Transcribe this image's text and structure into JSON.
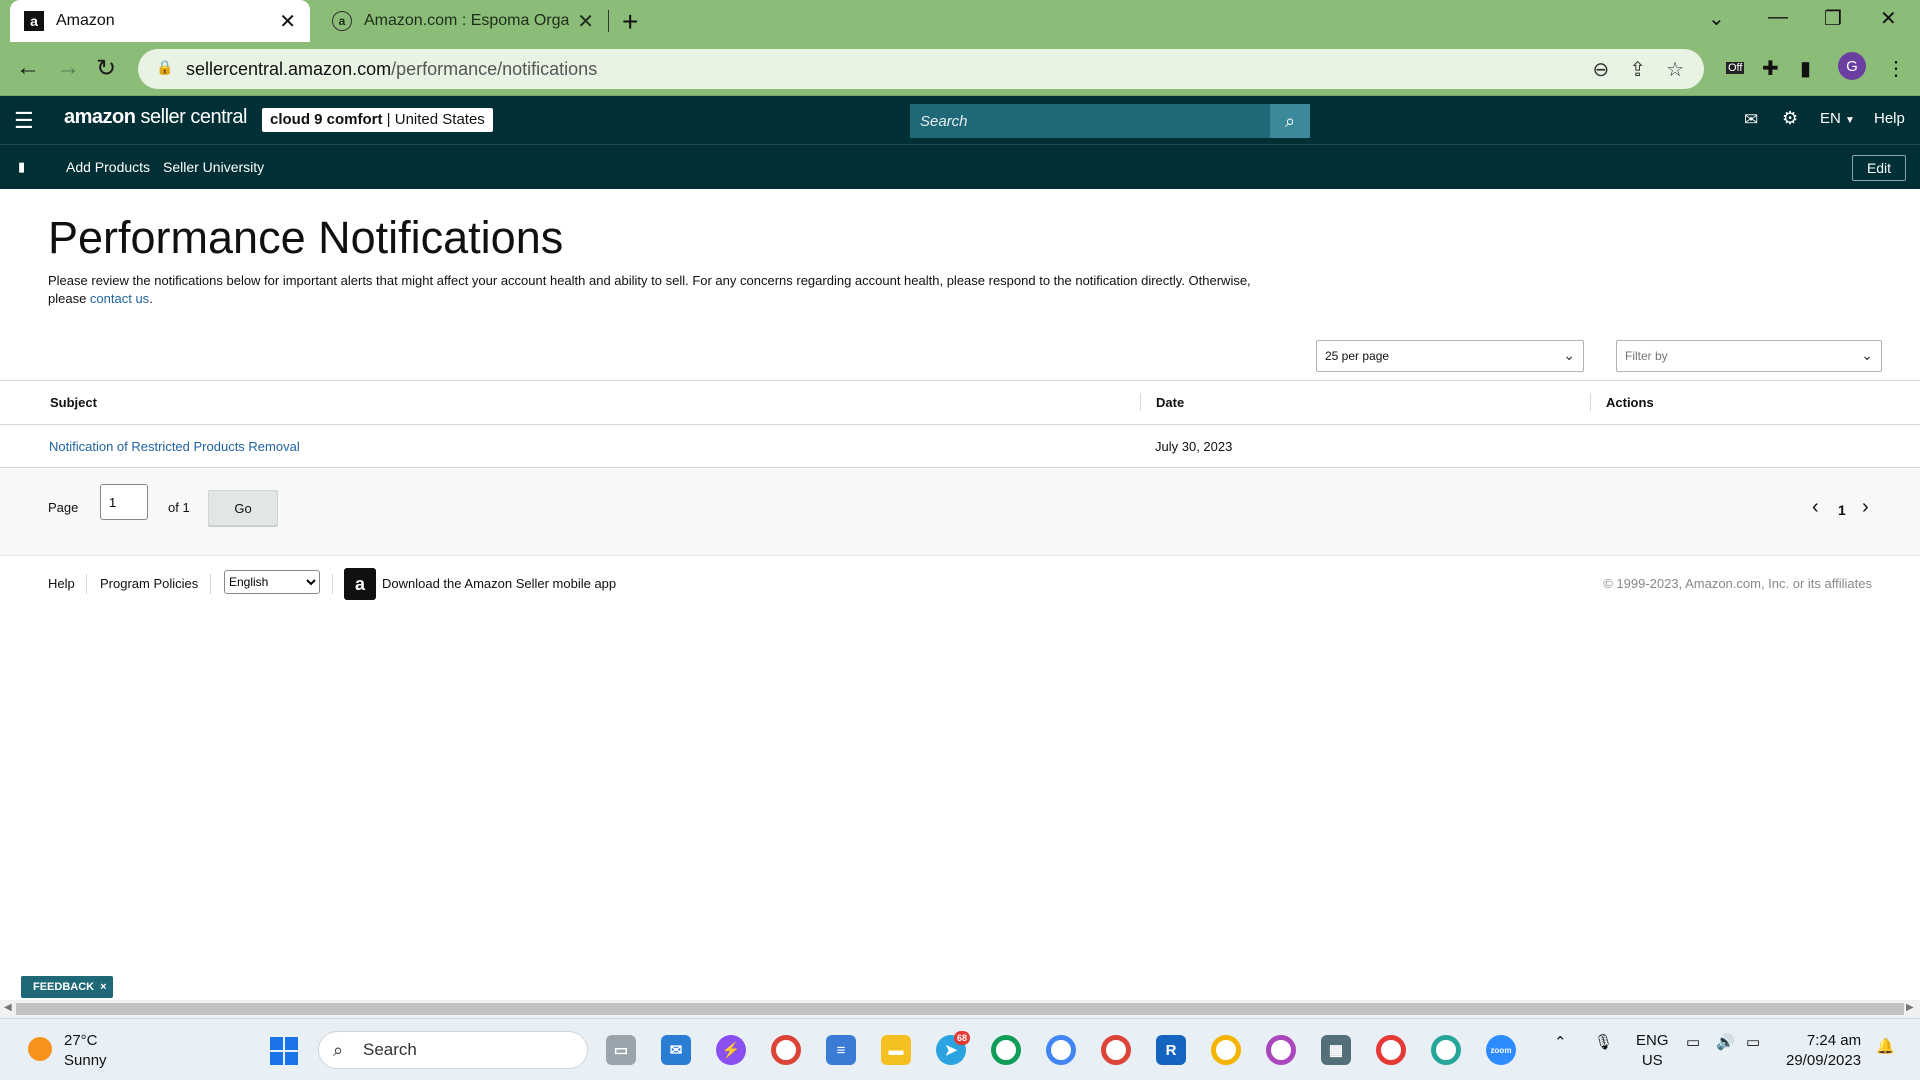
{
  "browser": {
    "tabs": [
      {
        "favicon": "a",
        "title": "Amazon",
        "close": "✕"
      },
      {
        "favicon": "a",
        "title": "Amazon.com : Espoma Organic",
        "close": "✕"
      }
    ],
    "new_tab": "+",
    "url_host": "sellercentral.amazon.com",
    "url_path": "/performance/notifications",
    "profile_initial": "G",
    "extension_badge": "Off"
  },
  "header": {
    "logo_brand": "amazon",
    "logo_suffix": "seller central",
    "store_name": "cloud 9 comfort",
    "store_sep": " | ",
    "store_region": "United States",
    "search_placeholder": "Search",
    "language": "EN",
    "help": "Help"
  },
  "subnav": {
    "items": [
      "Add Products",
      "Seller University"
    ],
    "edit": "Edit"
  },
  "page": {
    "title": "Performance Notifications",
    "description_pre": "Please review the notifications below for important alerts that might affect your account health and ability to sell. For any concerns regarding account health, please respond to the notification directly. Otherwise, please ",
    "contact_link": "contact us",
    "description_post": ".",
    "per_page": "25 per page",
    "filter_placeholder": "Filter by"
  },
  "table": {
    "headers": [
      "Subject",
      "Date",
      "Actions"
    ],
    "rows": [
      {
        "subject": "Notification of Restricted Products Removal",
        "date": "July 30, 2023",
        "actions": ""
      }
    ]
  },
  "pagination": {
    "page_label": "Page",
    "current": "1",
    "of_label": "of 1",
    "go": "Go",
    "prev": "‹",
    "page_number": "1",
    "next": "›"
  },
  "footer": {
    "help": "Help",
    "program_policies": "Program Policies",
    "language_option": "English",
    "app_text": "Download the Amazon Seller mobile app",
    "copyright": "© 1999-2023, Amazon.com, Inc. or its affiliates"
  },
  "feedback": {
    "label": "FEEDBACK",
    "close": "×"
  },
  "taskbar": {
    "temperature": "27°C",
    "condition": "Sunny",
    "search": "Search",
    "telegram_badge": "68",
    "lang_top": "ENG",
    "lang_bottom": "US",
    "time": "7:24 am",
    "date": "29/09/2023"
  }
}
